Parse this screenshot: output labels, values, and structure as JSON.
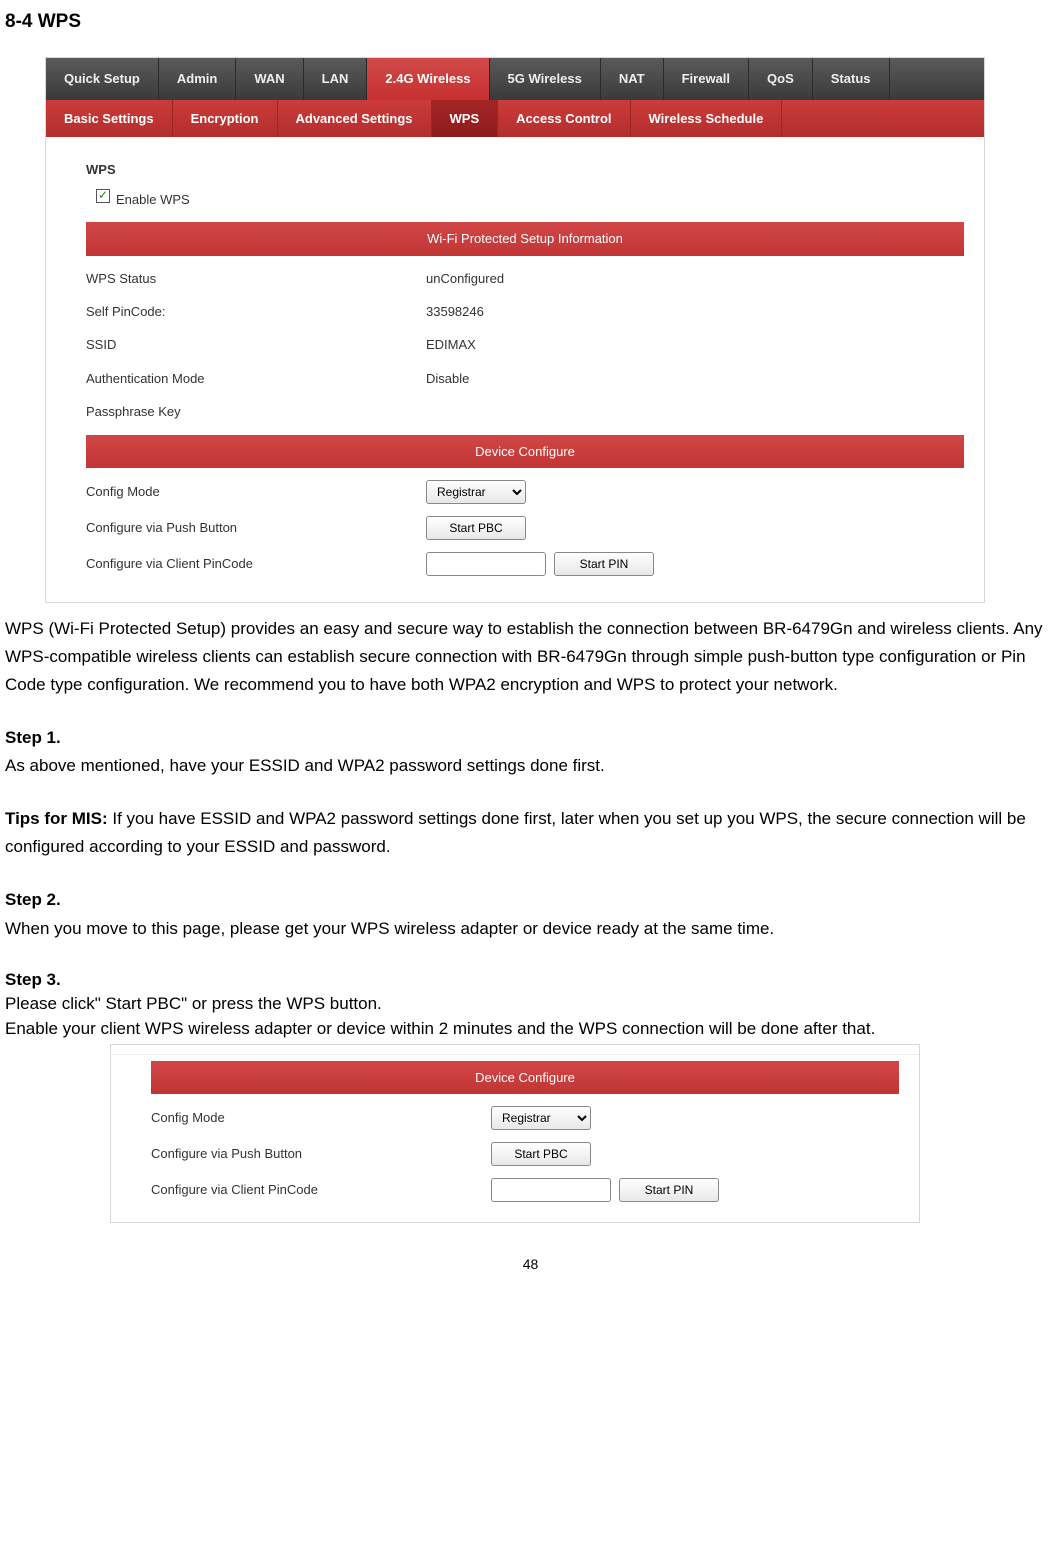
{
  "section_title": "8-4 WPS",
  "nav_main": [
    "Quick Setup",
    "Admin",
    "WAN",
    "LAN",
    "2.4G Wireless",
    "5G Wireless",
    "NAT",
    "Firewall",
    "QoS",
    "Status"
  ],
  "nav_main_active": 4,
  "nav_sub": [
    "Basic Settings",
    "Encryption",
    "Advanced Settings",
    "WPS",
    "Access Control",
    "Wireless Schedule"
  ],
  "nav_sub_active": 3,
  "wps_group_label": "WPS",
  "enable_wps_label": "Enable WPS",
  "header1": "Wi-Fi Protected Setup Information",
  "rows": [
    {
      "k": "WPS Status",
      "v": "unConfigured"
    },
    {
      "k": "Self PinCode:",
      "v": "33598246"
    },
    {
      "k": "SSID",
      "v": "EDIMAX"
    },
    {
      "k": "Authentication Mode",
      "v": "Disable"
    },
    {
      "k": "Passphrase Key",
      "v": ""
    }
  ],
  "header2": "Device Configure",
  "config_mode_label": "Config Mode",
  "config_mode_value": "Registrar",
  "push_button_label": "Configure via Push Button",
  "start_pbc_label": "Start PBC",
  "pin_label": "Configure via Client PinCode",
  "start_pin_label": "Start PIN",
  "paragraph_intro": "WPS (Wi‑Fi Protected Setup) provides an easy and secure way to establish the connection between BR-6479Gn and wireless clients. Any WPS‑compatible wireless clients can establish secure connection with BR-6479Gn through simple push‑button type configuration or Pin Code type configuration. We recommend you to have both WPA2 encryption and WPS to protect your network.",
  "step1_title": "Step 1.",
  "step1_body": "As above mentioned, have your ESSID and WPA2 password settings done first.",
  "tips_label": "Tips for MIS: ",
  "tips_body": "If you have ESSID and WPA2 password settings done first, later when you set up you WPS, the secure connection will be configured according to your ESSID and password.",
  "step2_title": "Step 2.",
  "step2_body": "When you move to this page, please get your WPS wireless adapter or device ready at the same time.",
  "step3_title": "Step 3.",
  "step3_line1": "Please click\" Start PBC\" or press the WPS button.",
  "step3_line2": "Enable your client WPS wireless adapter or device within 2 minutes and the WPS connection will be done after that.",
  "page_number": "48"
}
